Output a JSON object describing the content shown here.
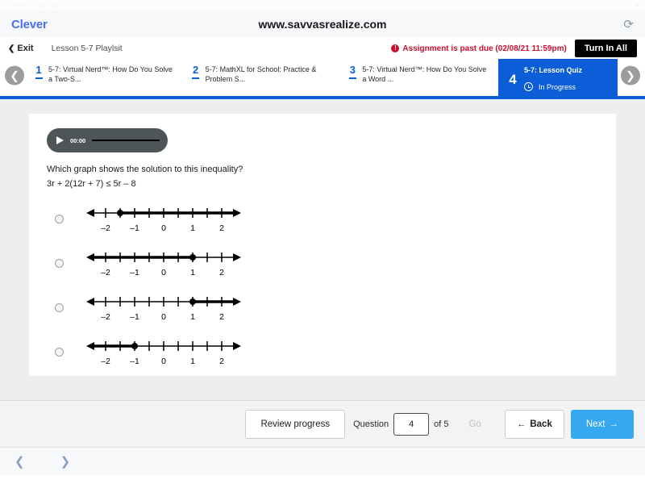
{
  "statusbar": {
    "time": "9:44 AM",
    "date": "Tue Mar 16",
    "battery": "71%",
    "wifi_icon": "wifi-icon"
  },
  "browser": {
    "profile_label": "Clever",
    "url": "www.savvasrealize.com",
    "reload_icon": "reload-icon",
    "back_icon": "chevron-left-icon",
    "forward_icon": "chevron-right-icon"
  },
  "appnav": {
    "exit_label": "Exit",
    "exit_icon": "chevron-left-icon",
    "playlist_title": "Lesson 5-7 Playlsit",
    "past_due_text": "Assignment is past due (02/08/21 11:59pm)",
    "past_due_icon": "alert-icon",
    "turn_in_label": "Turn In All",
    "prev_icon": "chevron-left-circle-icon",
    "next_icon": "chevron-right-circle-icon"
  },
  "tabs": [
    {
      "num": "1",
      "label": "5-7: Virtual Nerd™: How Do You Solve a Two-S...",
      "active": false
    },
    {
      "num": "2",
      "label": "5-7: MathXL for School: Practice & Problem S...",
      "active": false
    },
    {
      "num": "3",
      "label": "5-7: Virtual Nerd™: How Do You Solve a Word ...",
      "active": false
    },
    {
      "num": "4",
      "label": "5-7: Lesson Quiz",
      "active": true,
      "status": "In Progress",
      "status_icon": "clock-icon"
    }
  ],
  "question": {
    "audio": {
      "play_icon": "play-icon",
      "time": "00:00"
    },
    "prompt": "Which graph shows the solution to this inequality?",
    "inequality": "3r + 2(12r + 7) ≤ 5r – 8",
    "options": [
      {
        "id": "option-a",
        "ticks": [
          "–2",
          "–1",
          "0",
          "1",
          "2"
        ],
        "point": "–1",
        "direction": "right",
        "closed": true
      },
      {
        "id": "option-b",
        "ticks": [
          "–2",
          "–1",
          "0",
          "1",
          "2"
        ],
        "point": "1",
        "direction": "left",
        "closed": true
      },
      {
        "id": "option-c",
        "ticks": [
          "–2",
          "–1",
          "0",
          "1",
          "2"
        ],
        "point": "1",
        "direction": "right",
        "closed": true
      },
      {
        "id": "option-d",
        "ticks": [
          "–2",
          "–1",
          "0",
          "1",
          "2"
        ],
        "point": "–1",
        "direction": "left",
        "closed": true
      }
    ]
  },
  "bottombar": {
    "review_label": "Review progress",
    "question_label": "Question",
    "question_value": "4",
    "of_label": "of 5",
    "go_label": "Go",
    "back_label": "Back",
    "back_icon": "arrow-left-icon",
    "next_label": "Next",
    "next_icon": "arrow-right-icon"
  },
  "colors": {
    "accent_blue": "#0b5ed7",
    "next_blue": "#35a8ef",
    "past_due_red": "#c8102e",
    "clever_blue": "#4a6ff0"
  }
}
